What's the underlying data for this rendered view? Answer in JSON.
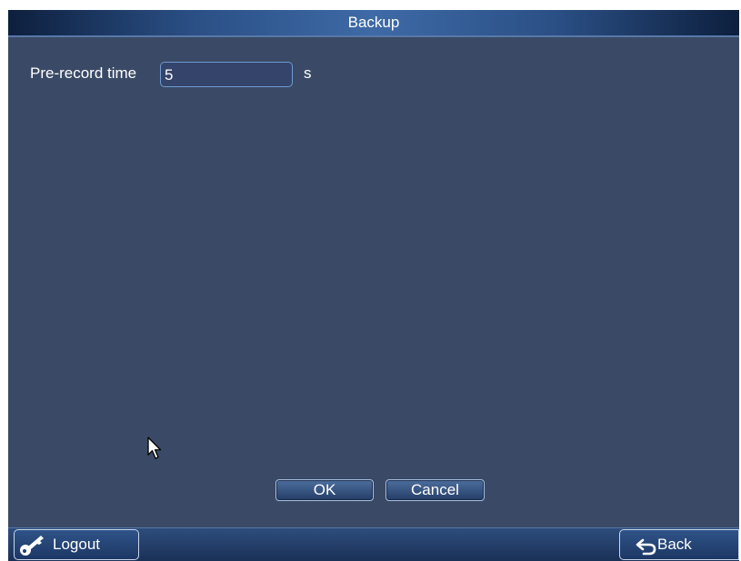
{
  "window": {
    "title": "Backup"
  },
  "form": {
    "pre_record_label": "Pre-record time",
    "pre_record_value": "5",
    "unit": "s"
  },
  "actions": {
    "ok_label": "OK",
    "cancel_label": "Cancel"
  },
  "footer": {
    "logout_label": "Logout",
    "back_label": "Back"
  },
  "icons": {
    "logout": "key-icon",
    "back": "return-arrow-icon",
    "pointer": "mouse-cursor-icon"
  },
  "colors": {
    "panel_bg": "#3a4a66",
    "title_bar": "#2a4f85",
    "input_border": "#6f9bd2"
  }
}
